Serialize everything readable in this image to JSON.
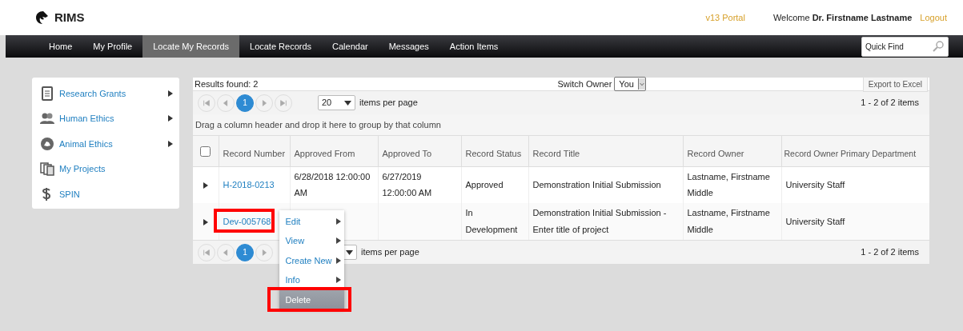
{
  "header": {
    "logo": "RIMS",
    "portal_link": "v13 Portal",
    "welcome": "Welcome **Dr. Firstname Lastname**",
    "logout": "Logout"
  },
  "nav": {
    "items": [
      {
        "label": "Home",
        "selected": false
      },
      {
        "label": "My Profile",
        "selected": false
      },
      {
        "label": "Locate My Records",
        "selected": true
      },
      {
        "label": "Locate Records",
        "selected": false
      },
      {
        "label": "Calendar",
        "selected": false
      },
      {
        "label": "Messages",
        "selected": false
      },
      {
        "label": "Action Items",
        "selected": false
      }
    ],
    "quick_find": {
      "placeholder": "Quick Find"
    }
  },
  "sidebar": {
    "items": [
      {
        "label": "Research Grants",
        "kind": "grants",
        "submenu": true
      },
      {
        "label": "Human Ethics",
        "kind": "people",
        "submenu": true
      },
      {
        "label": "Animal Ethics",
        "kind": "animal",
        "submenu": true
      },
      {
        "label": "My Projects",
        "kind": "projects",
        "submenu": false
      },
      {
        "label": "SPIN",
        "kind": "money",
        "submenu": false
      }
    ]
  },
  "results": {
    "count": "Results found: 2",
    "switch_owner_label": "Switch Owner",
    "switch_owner_value": "You",
    "export_button": "Export to Excel"
  },
  "pager_top": {
    "current_page": "1",
    "page_size": "20",
    "per_page_label": "items per page",
    "summary": "1 - 2 of 2 items"
  },
  "group_hint": "Drag a column header and drop it here to group by that column",
  "table": {
    "select_all": {
      "checked": false
    },
    "columns": [
      "Record Number",
      "Approved From",
      "Approved To",
      "Record Status",
      "Record Title",
      "Record Owner",
      "Record Owner Primary Department"
    ],
    "rows": [
      {
        "record_number": "H-2018-0213",
        "approved_from": "6/28/2018 12:00:00 AM",
        "approved_to": "6/27/2019 12:00:00 AM",
        "status": "Approved",
        "title": "Demonstration Initial Submission",
        "owner": "Lastname, Firstname Middle",
        "department": "University Staff",
        "highlighted": false
      },
      {
        "record_number": "Dev-005768",
        "status": "In Development",
        "title": "Demonstration Initial Submission - Enter title of project",
        "owner": "Lastname, Firstname Middle",
        "department": "University Staff",
        "highlighted": true
      }
    ]
  },
  "pager_bottom": {
    "current_page": "1",
    "per_page_label": "items per page",
    "summary": "1 - 2 of 2 items"
  },
  "context_menu": {
    "items": [
      {
        "label": "Edit",
        "submenu": true,
        "disabled": false,
        "highlighted": false
      },
      {
        "label": "View",
        "submenu": true,
        "disabled": false,
        "highlighted": false
      },
      {
        "label": "Create New",
        "submenu": true,
        "disabled": false,
        "highlighted": false
      },
      {
        "label": "Info",
        "submenu": true,
        "disabled": false,
        "highlighted": false
      },
      {
        "label": "Delete",
        "submenu": false,
        "disabled": true,
        "highlighted": true
      }
    ]
  }
}
